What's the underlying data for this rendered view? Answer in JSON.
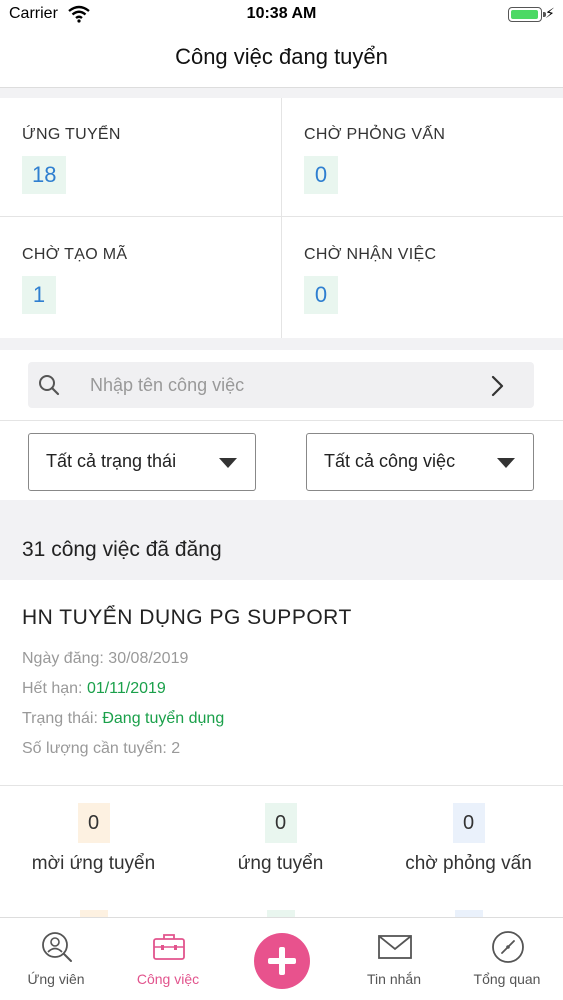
{
  "status_bar": {
    "carrier": "Carrier",
    "time": "10:38 AM",
    "battery_level": 0.9
  },
  "header": {
    "title": "Công việc đang tuyển"
  },
  "stats": [
    {
      "label": "ỨNG TUYỂN",
      "value": "18"
    },
    {
      "label": "CHỜ PHỎNG VẤN",
      "value": "0"
    },
    {
      "label": "CHỜ TẠO MÃ",
      "value": "1"
    },
    {
      "label": "CHỜ NHẬN VIỆC",
      "value": "0"
    }
  ],
  "search": {
    "placeholder": "Nhập tên công việc",
    "value": ""
  },
  "filters": {
    "status_select": "Tất cả trạng thái",
    "job_select": "Tất cả công việc"
  },
  "job_count_title": "31 công việc đã đăng",
  "job": {
    "title": "HN TUYỂN DỤNG PG SUPPORT",
    "posted_label": "Ngày đăng:",
    "posted_value": "30/08/2019",
    "expiry_label": "Hết hạn:",
    "expiry_value": "01/11/2019",
    "status_label": "Trạng thái:",
    "status_value": "Đang tuyển dụng",
    "quantity_label": "Số lượng cần tuyển:",
    "quantity_value": "2",
    "metrics": [
      {
        "value": "0",
        "label": "mời ứng tuyển"
      },
      {
        "value": "0",
        "label": "ứng tuyển"
      },
      {
        "value": "0",
        "label": "chờ phỏng vấn"
      }
    ]
  },
  "colors": {
    "accent_pink": "#e8528d",
    "status_green": "#1aa04a",
    "value_blue": "#2f7fd0"
  },
  "tab_bar": [
    {
      "label": "Ứng viên",
      "icon": "candidate-icon",
      "active": false
    },
    {
      "label": "Công việc",
      "icon": "briefcase-icon",
      "active": true
    },
    {
      "label": "",
      "icon": "plus-icon",
      "active": false
    },
    {
      "label": "Tin nhắn",
      "icon": "mail-icon",
      "active": false
    },
    {
      "label": "Tổng quan",
      "icon": "compass-icon",
      "active": false
    }
  ]
}
